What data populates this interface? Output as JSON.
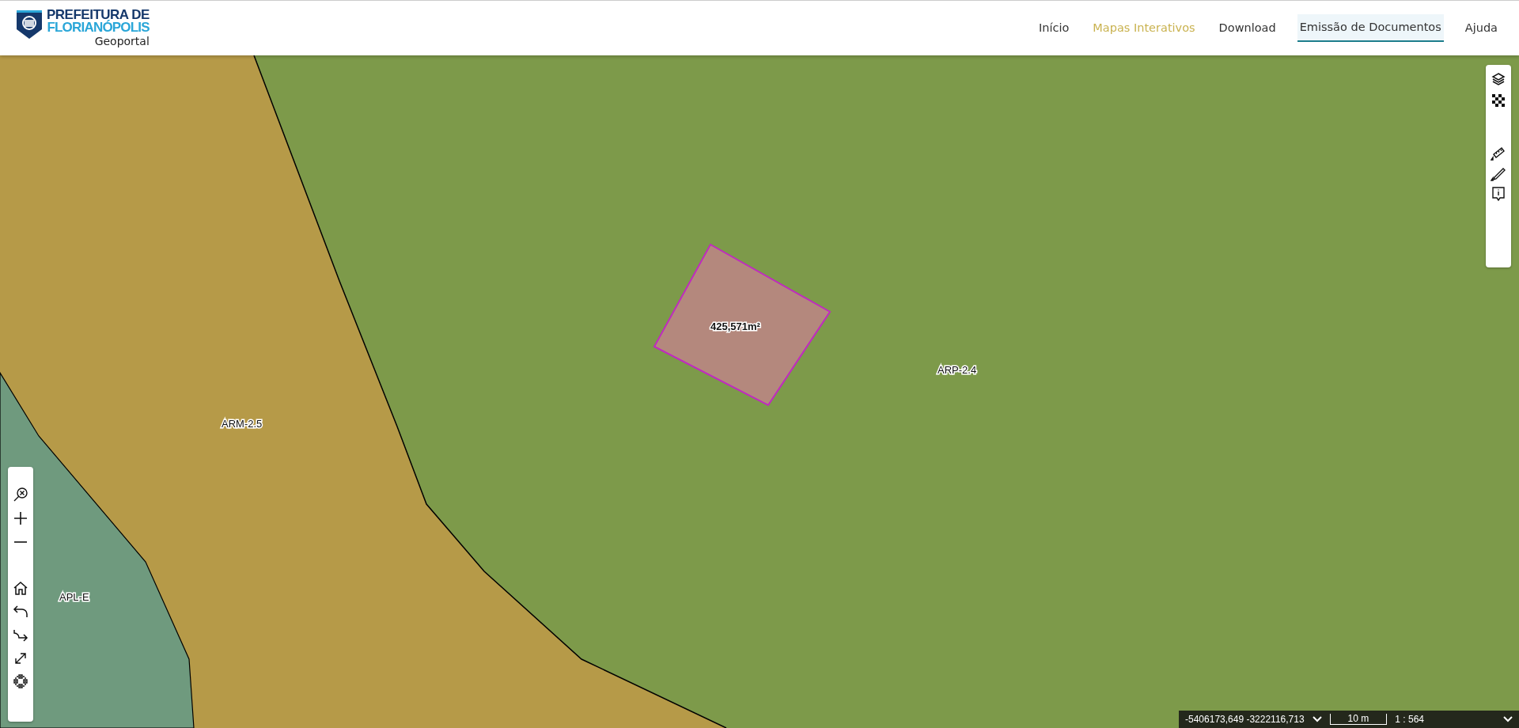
{
  "header": {
    "logo": {
      "line_1": "PREFEITURA DE",
      "line_2": "FLORIANÓPOLIS",
      "subtitle": "Geoportal"
    },
    "nav": [
      {
        "label": "Início",
        "selected": false,
        "highlighted": false
      },
      {
        "label": "Mapas Interativos",
        "selected": false,
        "highlighted": true
      },
      {
        "label": "Download",
        "selected": false,
        "highlighted": false
      },
      {
        "label": "Emissão de Documentos",
        "selected": true,
        "highlighted": false
      },
      {
        "label": "Ajuda",
        "selected": false,
        "highlighted": false
      }
    ]
  },
  "map": {
    "zone_labels": [
      "ARM-2.5",
      "ARP-2.4",
      "APL-E"
    ],
    "parcel": {
      "area": "425,571m²"
    }
  },
  "status_bar": {
    "coordinates": "-5406173,649 -3222116,713",
    "scale_bar": "10 m",
    "scale": "1 : 564"
  }
}
